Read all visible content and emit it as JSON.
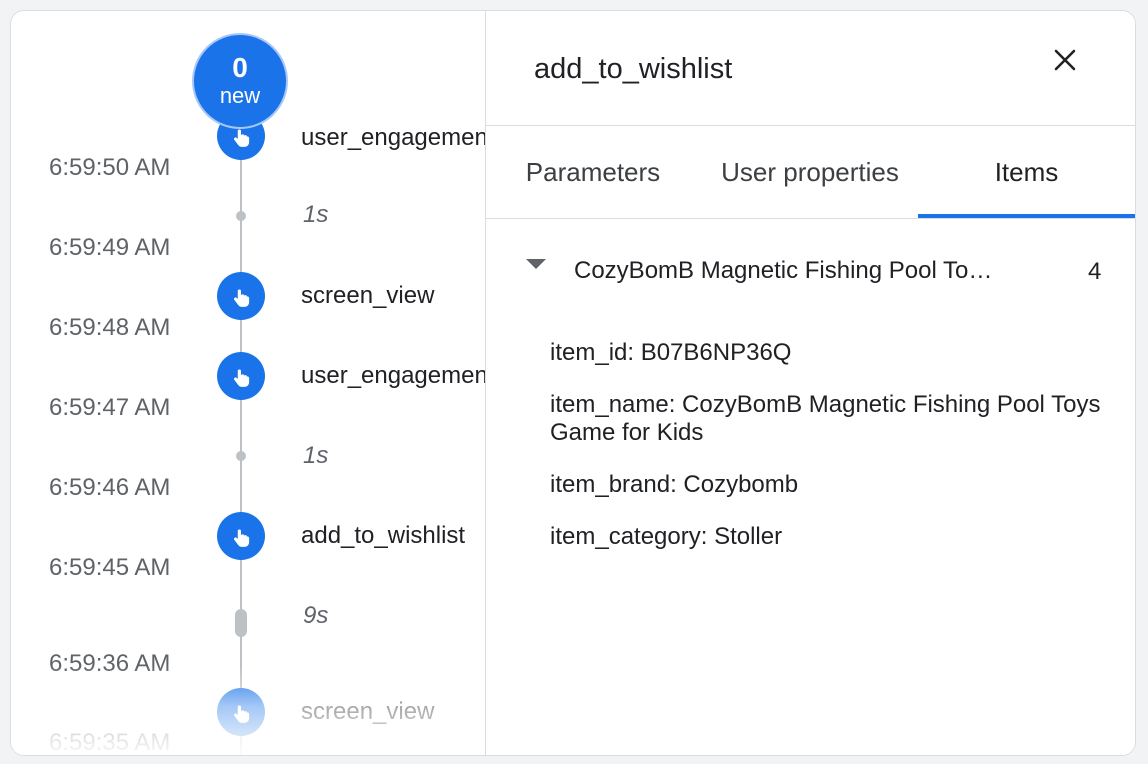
{
  "timeline": {
    "new_badge": {
      "count": "0",
      "label": "new"
    },
    "times": [
      "6:59:50 AM",
      "6:59:49 AM",
      "6:59:48 AM",
      "6:59:47 AM",
      "6:59:46 AM",
      "6:59:45 AM",
      "6:59:36 AM",
      "6:59:35 AM"
    ],
    "events": [
      {
        "name": "user_engagement",
        "icon": "touch-icon"
      },
      {
        "name": "screen_view",
        "icon": "touch-icon"
      },
      {
        "name": "user_engagement",
        "icon": "touch-icon"
      },
      {
        "name": "add_to_wishlist",
        "icon": "touch-icon"
      },
      {
        "name": "screen_view",
        "icon": "touch-icon"
      }
    ],
    "durations": [
      "1s",
      "1s",
      "9s"
    ]
  },
  "panel": {
    "title": "add_to_wishlist",
    "close_icon": "close-icon",
    "tabs": [
      {
        "label": "Parameters",
        "active": false
      },
      {
        "label": "User properties",
        "active": false
      },
      {
        "label": "Items",
        "active": true
      }
    ],
    "item": {
      "name": "CozyBomB Magnetic Fishing Pool Toys Game for Kids",
      "count": "4",
      "expanded": true,
      "params": [
        "item_id: B07B6NP36Q",
        "item_name: CozyBomB Magnetic Fishing Pool Toys Game for Kids",
        "item_brand: Cozybomb",
        "item_category: Stoller"
      ]
    }
  },
  "colors": {
    "accent": "#1a73e8",
    "line": "#bdc1c6",
    "muted_text": "#5f6368"
  }
}
